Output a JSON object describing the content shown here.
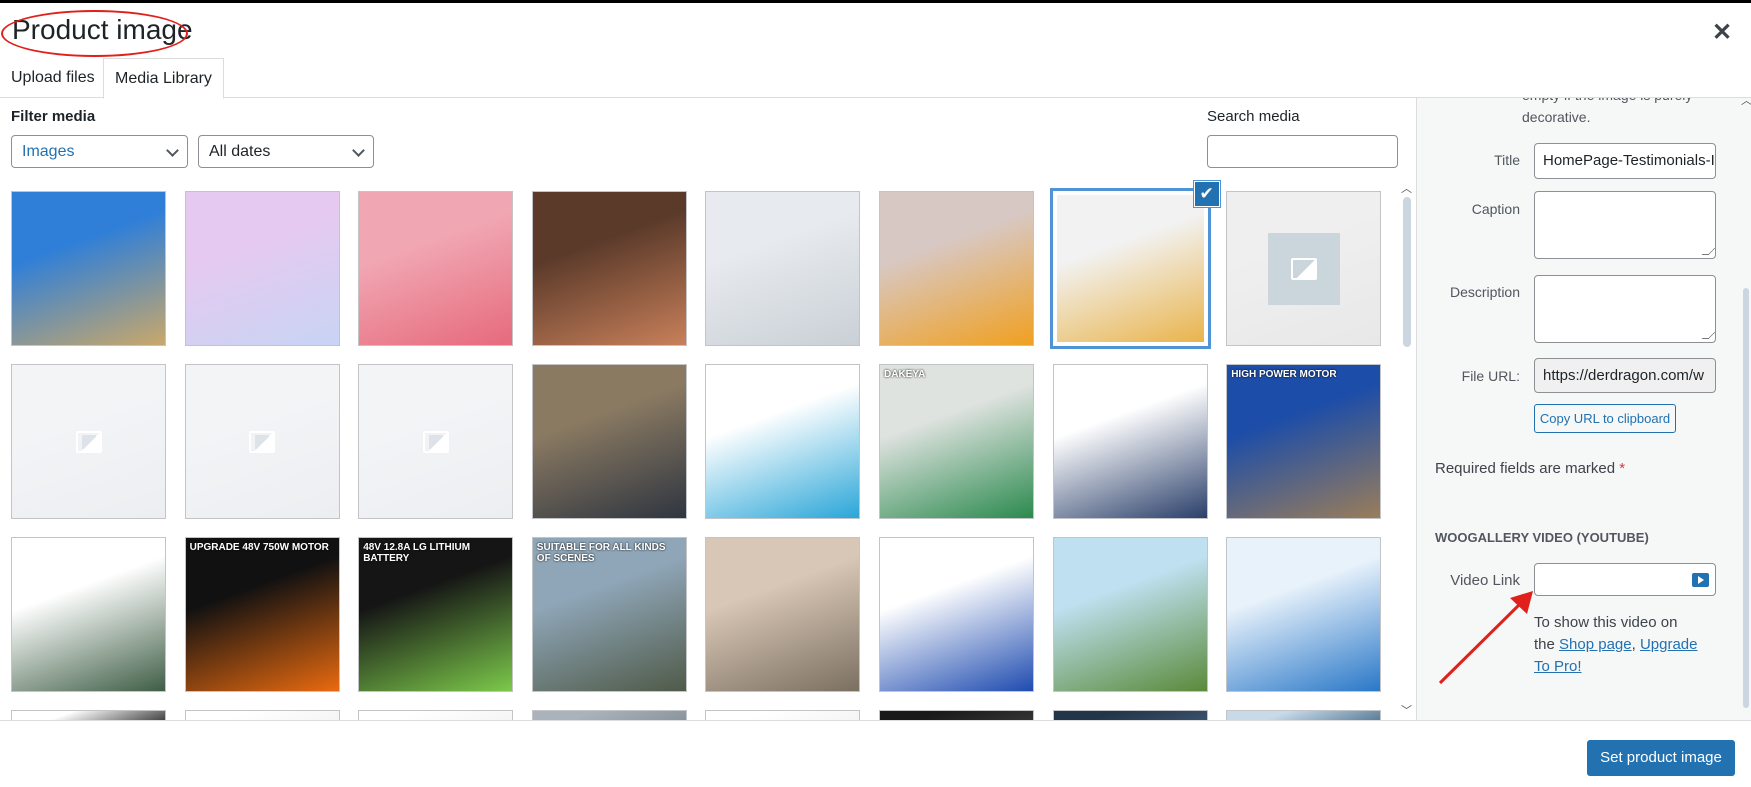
{
  "modal": {
    "title": "Product image",
    "close_icon": "close-icon"
  },
  "tabs": [
    {
      "label": "Upload files",
      "active": false
    },
    {
      "label": "Media Library",
      "active": true
    }
  ],
  "filters": {
    "label": "Filter media",
    "type_value": "Images",
    "date_value": "All dates",
    "search_label": "Search media",
    "search_value": ""
  },
  "thumbs": [
    {
      "kind": "photo",
      "colors": [
        "#2f7fd8",
        "#c9a86a"
      ]
    },
    {
      "kind": "photo",
      "colors": [
        "#e6c9f0",
        "#c8d4f4"
      ]
    },
    {
      "kind": "photo",
      "colors": [
        "#f1a7b3",
        "#e66a7c"
      ]
    },
    {
      "kind": "photo",
      "colors": [
        "#5b3a2a",
        "#c8805a"
      ]
    },
    {
      "kind": "placeholder-light",
      "colors": [
        "#e7eaee",
        "#c9d0d6"
      ]
    },
    {
      "kind": "photo",
      "colors": [
        "#d8c8c3",
        "#f0a020"
      ]
    },
    {
      "kind": "photo",
      "colors": [
        "#f2f2f2",
        "#e9b44c"
      ],
      "selected": true
    },
    {
      "kind": "placeholder",
      "colors": [
        "#efefef",
        "#e8e8e8"
      ]
    },
    {
      "kind": "placeholder-small",
      "colors": [
        "#f3f4f6",
        "#eceef1"
      ]
    },
    {
      "kind": "placeholder-small",
      "colors": [
        "#f3f4f6",
        "#eceef1"
      ]
    },
    {
      "kind": "placeholder-small",
      "colors": [
        "#f3f4f6",
        "#eceef1"
      ]
    },
    {
      "kind": "photo",
      "colors": [
        "#8a7a62",
        "#2f3540"
      ]
    },
    {
      "kind": "photo",
      "colors": [
        "#ffffff",
        "#2aa6d8"
      ]
    },
    {
      "kind": "photo",
      "colors": [
        "#dfe3e0",
        "#2b8a4e"
      ],
      "caption": "DAKEYA"
    },
    {
      "kind": "photo",
      "colors": [
        "#ffffff",
        "#2a3f6a"
      ]
    },
    {
      "kind": "photo",
      "colors": [
        "#1c4da8",
        "#9a7d5a"
      ],
      "caption": "HIGH POWER MOTOR"
    },
    {
      "kind": "photo",
      "colors": [
        "#ffffff",
        "#3f5e46"
      ]
    },
    {
      "kind": "photo",
      "colors": [
        "#111111",
        "#e96a10"
      ],
      "caption": "UPGRADE 48V 750W MOTOR"
    },
    {
      "kind": "photo",
      "colors": [
        "#151515",
        "#7cc94a"
      ],
      "caption": "48V 12.8A LG LITHIUM BATTERY"
    },
    {
      "kind": "photo",
      "colors": [
        "#8fa6b8",
        "#4f5a48"
      ],
      "caption": "SUITABLE FOR ALL KINDS OF SCENES"
    },
    {
      "kind": "photo",
      "colors": [
        "#d8c6b6",
        "#7b7060"
      ]
    },
    {
      "kind": "photo",
      "colors": [
        "#ffffff",
        "#1f4cb0"
      ]
    },
    {
      "kind": "photo",
      "colors": [
        "#bfe0f0",
        "#5a8a3a"
      ]
    },
    {
      "kind": "photo",
      "colors": [
        "#e8f2fb",
        "#2a78c8"
      ]
    },
    {
      "kind": "photo",
      "colors": [
        "#ffffff",
        "#444444"
      ]
    },
    {
      "kind": "photo",
      "colors": [
        "#ffffff",
        "#f5f5f5"
      ]
    },
    {
      "kind": "photo",
      "colors": [
        "#ffffff",
        "#f5f5f5"
      ]
    },
    {
      "kind": "photo",
      "colors": [
        "#aab3bb",
        "#8a949c"
      ]
    },
    {
      "kind": "photo",
      "colors": [
        "#ffffff",
        "#f5f5f5"
      ]
    },
    {
      "kind": "photo",
      "colors": [
        "#1a1a1a",
        "#333333"
      ]
    },
    {
      "kind": "photo",
      "colors": [
        "#22364a",
        "#3a506a"
      ]
    },
    {
      "kind": "photo",
      "colors": [
        "#c8dae8",
        "#5a7e9a"
      ]
    }
  ],
  "details": {
    "alt_help_tail_1": "empty if the image is purely",
    "alt_help_tail_2": "decorative.",
    "title_label": "Title",
    "title_value": "HomePage-Testimonials-I",
    "caption_label": "Caption",
    "caption_value": "",
    "description_label": "Description",
    "description_value": "",
    "file_url_label": "File URL:",
    "file_url_value": "https://derdragon.com/w",
    "copy_url_label": "Copy URL to clipboard",
    "required_text": "Required fields are marked",
    "required_mark": "*"
  },
  "woogallery": {
    "heading": "WOOGALLERY VIDEO (YOUTUBE)",
    "video_link_label": "Video Link",
    "video_link_value": "",
    "help_1": "To show this video on",
    "help_2": "the",
    "shop_link": "Shop page",
    "comma": ",",
    "upgrade_link_1": "Upgrade",
    "upgrade_link_2": "To Pro!"
  },
  "footer": {
    "set_button": "Set product image"
  },
  "annotation_color": "#e0201a",
  "accent_color": "#2271b1"
}
